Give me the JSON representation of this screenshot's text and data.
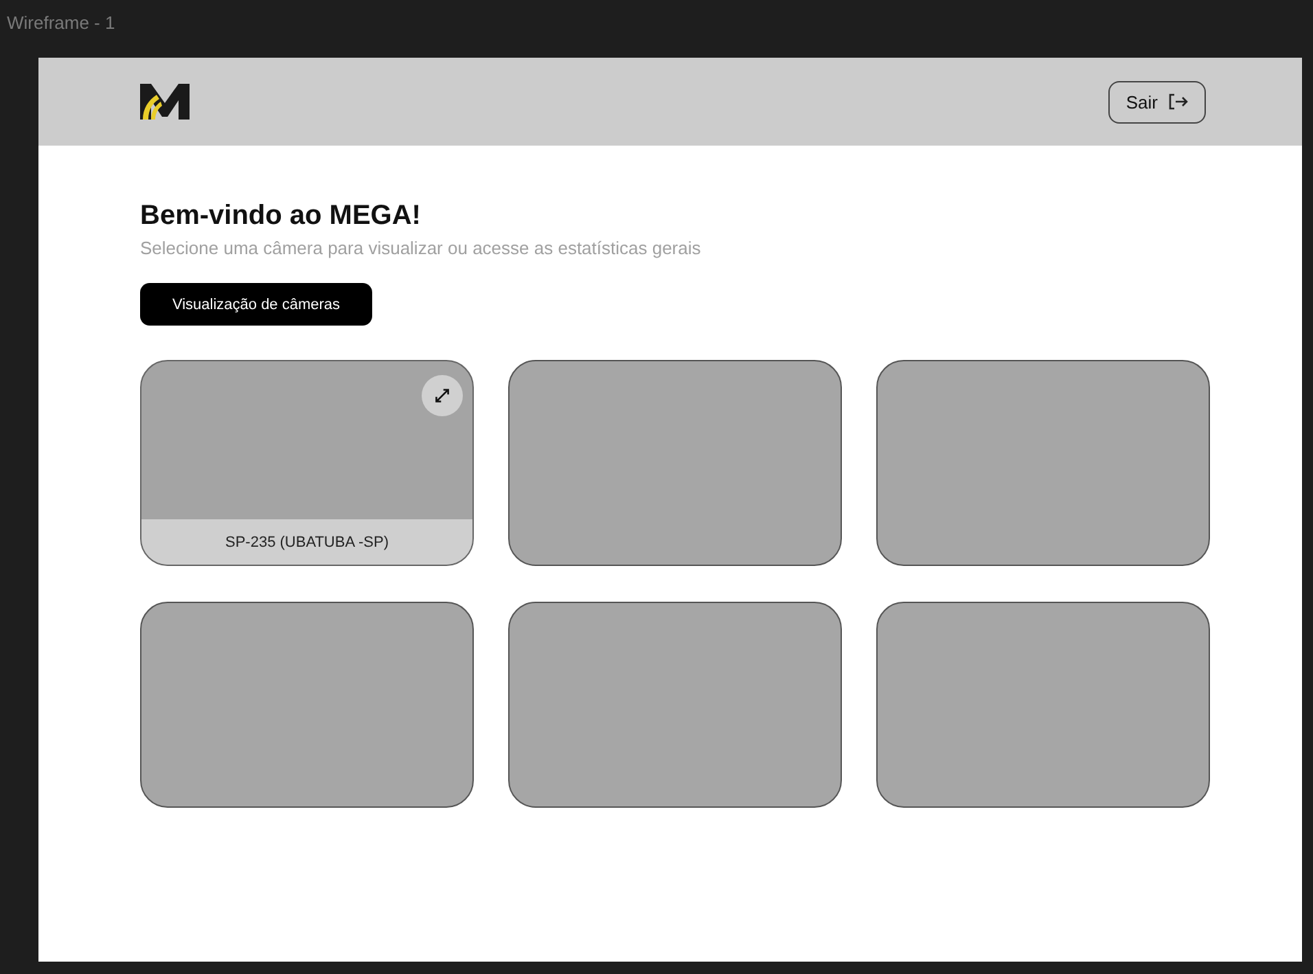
{
  "window": {
    "title": "Wireframe - 1"
  },
  "header": {
    "logout_button": "Sair"
  },
  "heading": "Bem-vindo ao MEGA!",
  "subtitle": "Selecione uma câmera para visualizar ou acesse as estatísticas gerais",
  "primary_button": "Visualização de câmeras",
  "cameras": [
    {
      "label": "SP-235 (UBATUBA -SP)",
      "hovered": true
    },
    {
      "hovered": false
    },
    {
      "hovered": false
    },
    {
      "hovered": false
    },
    {
      "hovered": false
    },
    {
      "hovered": false
    }
  ]
}
